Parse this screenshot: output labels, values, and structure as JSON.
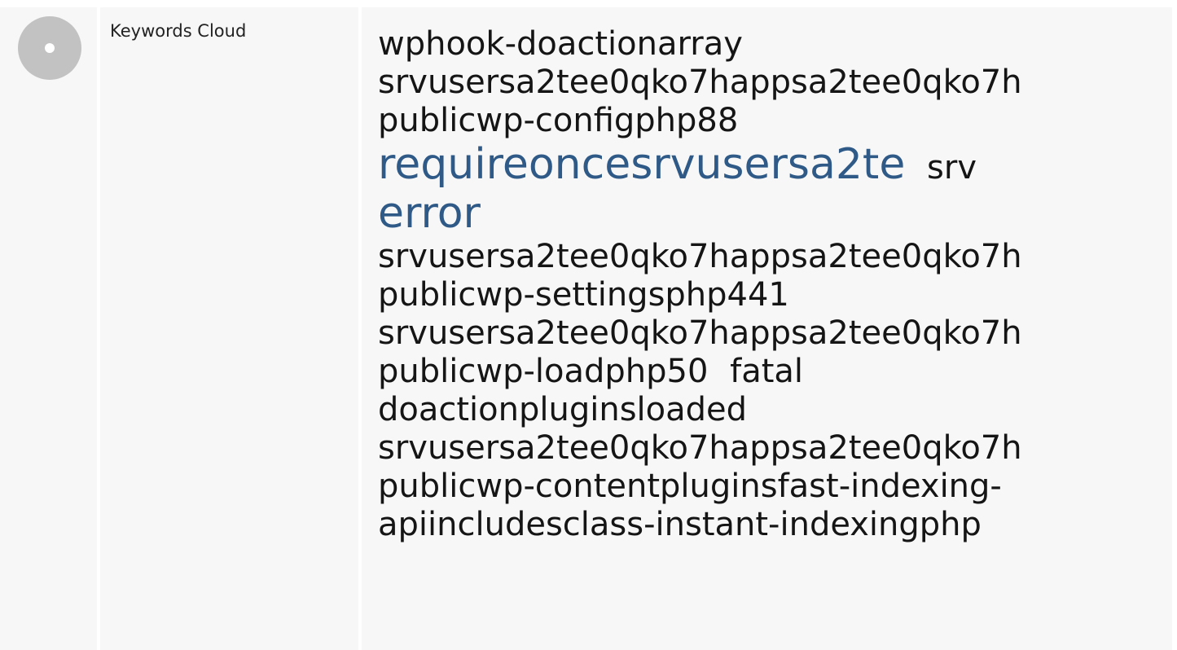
{
  "row": {
    "label": "Keywords Cloud",
    "status_icon": "neutral-circle-icon",
    "status_color": "#c2c2c2",
    "accent_color": "#2f5a87"
  },
  "keywords": [
    {
      "text": "wphook-doactionarray",
      "emphasis": "normal"
    },
    {
      "text": "srvusersa2tee0qko7happsa2tee0qko7h publicwp-configphp88",
      "emphasis": "normal"
    },
    {
      "text": "requireoncesrvusersa2te",
      "emphasis": "high"
    },
    {
      "text": "srv",
      "emphasis": "normal"
    },
    {
      "text": "error",
      "emphasis": "high"
    },
    {
      "text": "srvusersa2tee0qko7happsa2tee0qko7h publicwp-settingsphp441",
      "emphasis": "normal"
    },
    {
      "text": "srvusersa2tee0qko7happsa2tee0qko7h publicwp-loadphp50",
      "emphasis": "normal"
    },
    {
      "text": "fatal",
      "emphasis": "normal"
    },
    {
      "text": "doactionpluginsloaded",
      "emphasis": "normal"
    },
    {
      "text": "srvusersa2tee0qko7happsa2tee0qko7h publicwp-contentpluginsfast-indexing-apiincludesclass-instant-indexingphp",
      "emphasis": "normal"
    }
  ]
}
